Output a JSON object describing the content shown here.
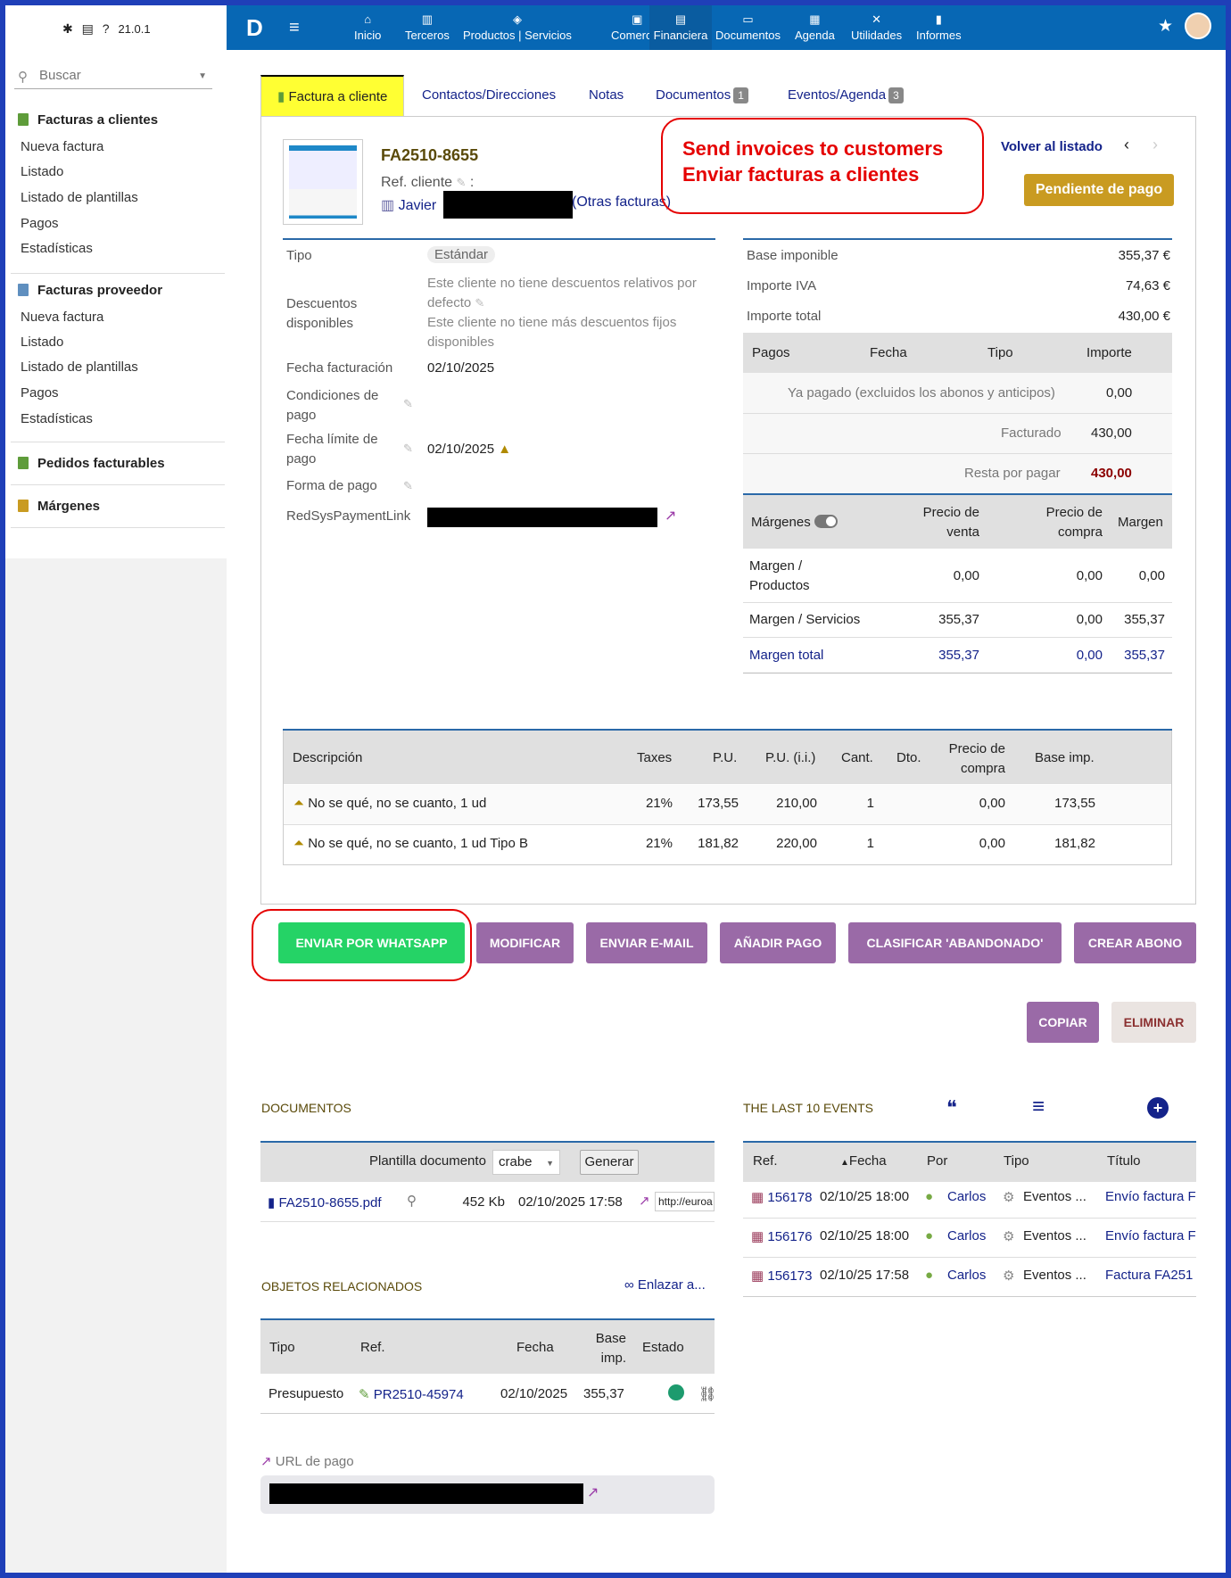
{
  "left": {
    "version": "21.0.1",
    "search_placeholder": "Buscar",
    "sections": [
      {
        "title": "Facturas a clientes",
        "items": [
          "Nueva factura",
          "Listado",
          "Listado de plantillas",
          "Pagos",
          "Estadísticas"
        ]
      },
      {
        "title": "Facturas proveedor",
        "items": [
          "Nueva factura",
          "Listado",
          "Listado de plantillas",
          "Pagos",
          "Estadísticas"
        ]
      },
      {
        "title": "Pedidos facturables"
      },
      {
        "title": "Márgenes"
      }
    ]
  },
  "topnav": {
    "logo": "D",
    "items": [
      "Inicio",
      "Terceros",
      "Productos | Servicios",
      "Comercial",
      "Financiera",
      "Documentos",
      "Agenda",
      "Utilidades",
      "Informes"
    ]
  },
  "tabs": {
    "t0": "Factura a cliente",
    "t1": "Contactos/Direcciones",
    "t2": "Notas",
    "t3": "Documentos",
    "t3_badge": "1",
    "t4": "Eventos/Agenda",
    "t4_badge": "3"
  },
  "invoice": {
    "ref": "FA2510-8655",
    "ref_cliente_label": "Ref. cliente",
    "customer": "Javier",
    "otras": "(Otras facturas)",
    "back": "Volver al listado",
    "status": "Pendiente de pago",
    "annotation_line1": "Send invoices to customers",
    "annotation_line2": "Enviar facturas a clientes"
  },
  "fields": {
    "tipo_l": "Tipo",
    "tipo_v": "Estándar",
    "desc_l": "Descuentos disponibles",
    "desc_v1": "Este cliente no tiene descuentos relativos por defecto",
    "desc_v2": "Este cliente no tiene más descuentos fijos disponibles",
    "fecha_l": "Fecha facturación",
    "fecha_v": "02/10/2025",
    "cond_l": "Condiciones de pago",
    "limite_l": "Fecha límite de pago",
    "limite_v": "02/10/2025",
    "forma_l": "Forma de pago",
    "redsys_l": "RedSysPaymentLink"
  },
  "totals": {
    "base_l": "Base imponible",
    "base_v": "355,37 €",
    "iva_l": "Importe IVA",
    "iva_v": "74,63 €",
    "total_l": "Importe total",
    "total_v": "430,00 €",
    "h_pagos": "Pagos",
    "h_fecha": "Fecha",
    "h_tipo": "Tipo",
    "h_importe": "Importe",
    "pagado_l": "Ya pagado (excluidos los abonos y anticipos)",
    "pagado_v": "0,00",
    "facturado_l": "Facturado",
    "facturado_v": "430,00",
    "resta_l": "Resta por pagar",
    "resta_v": "430,00"
  },
  "margins": {
    "h0": "Márgenes",
    "h1": "Precio de venta",
    "h2": "Precio de compra",
    "h3": "Margen",
    "rows": [
      {
        "label": "Margen / Productos",
        "venta": "0,00",
        "compra": "0,00",
        "margen": "0,00"
      },
      {
        "label": "Margen / Servicios",
        "venta": "355,37",
        "compra": "0,00",
        "margen": "355,37"
      },
      {
        "label": "Margen total",
        "venta": "355,37",
        "compra": "0,00",
        "margen": "355,37"
      }
    ]
  },
  "lines": {
    "headers": [
      "Descripción",
      "Taxes",
      "P.U.",
      "P.U. (i.i.)",
      "Cant.",
      "Dto.",
      "Precio de compra",
      "Base imp."
    ],
    "rows": [
      {
        "desc": "No se qué, no se cuanto, 1 ud",
        "tax": "21%",
        "pu": "173,55",
        "pui": "210,00",
        "qty": "1",
        "compra": "0,00",
        "base": "173,55"
      },
      {
        "desc": "No se qué, no se cuanto, 1 ud Tipo B",
        "tax": "21%",
        "pu": "181,82",
        "pui": "220,00",
        "qty": "1",
        "compra": "0,00",
        "base": "181,82"
      }
    ]
  },
  "buttons": {
    "whatsapp": "ENVIAR POR WHATSAPP",
    "modificar": "MODIFICAR",
    "email": "ENVIAR E-MAIL",
    "pago": "AÑADIR PAGO",
    "abandonado": "CLASIFICAR 'ABANDONADO'",
    "abono": "CREAR ABONO",
    "copiar": "COPIAR",
    "eliminar": "ELIMINAR"
  },
  "documents": {
    "title": "DOCUMENTOS",
    "plantilla_l": "Plantilla documento",
    "plantilla_v": "crabe",
    "generar": "Generar",
    "file": "FA2510-8655.pdf",
    "size": "452 Kb",
    "date": "02/10/2025 17:58",
    "url": "http://euroa"
  },
  "events": {
    "title": "THE LAST 10 EVENTS",
    "headers": [
      "Ref.",
      "Fecha",
      "Por",
      "Tipo",
      "Título"
    ],
    "rows": [
      {
        "ref": "156178",
        "fecha": "02/10/25 18:00",
        "por": "Carlos",
        "tipo": "Eventos ...",
        "titulo": "Envío factura F"
      },
      {
        "ref": "156176",
        "fecha": "02/10/25 18:00",
        "por": "Carlos",
        "tipo": "Eventos ...",
        "titulo": "Envío factura F"
      },
      {
        "ref": "156173",
        "fecha": "02/10/25 17:58",
        "por": "Carlos",
        "tipo": "Eventos ...",
        "titulo": "Factura FA251"
      }
    ]
  },
  "related": {
    "title": "OBJETOS RELACIONADOS",
    "link": "Enlazar a...",
    "headers": [
      "Tipo",
      "Ref.",
      "Fecha",
      "Base imp.",
      "Estado"
    ],
    "row": {
      "tipo": "Presupuesto",
      "ref": "PR2510-45974",
      "fecha": "02/10/2025",
      "base": "355,37"
    }
  },
  "payurl": {
    "label": "URL de pago"
  },
  "colors": {
    "accent": "#0767b4",
    "whatsapp": "#25d366",
    "action": "#9a6aa7",
    "status": "#c99b21",
    "annotation": "#e50000"
  }
}
